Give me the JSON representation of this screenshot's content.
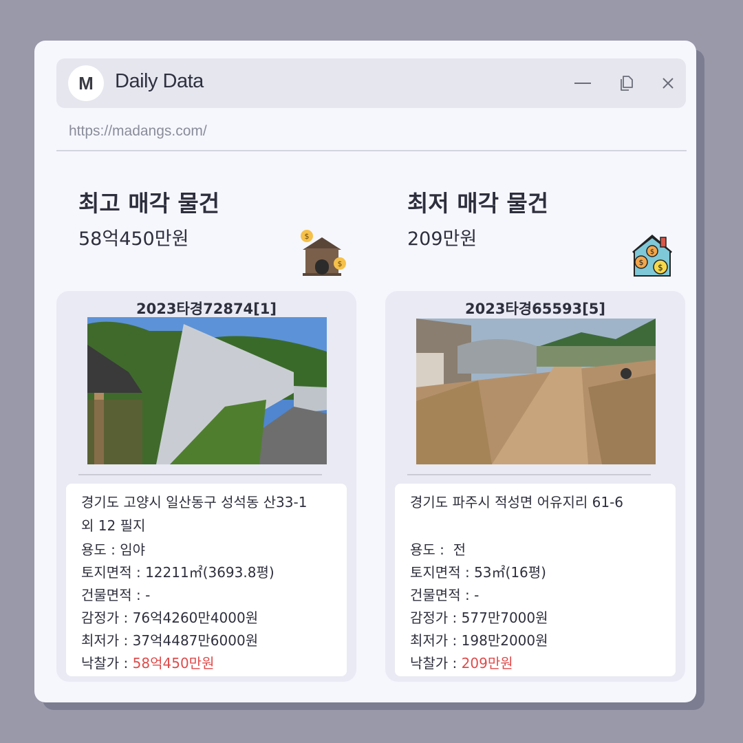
{
  "app": {
    "avatar_letter": "M",
    "title": "Daily Data",
    "url": "https://madangs.com/"
  },
  "icons": {
    "minimize": "minimize-icon",
    "copy": "copy-icon",
    "close": "close-icon",
    "left_section": "house-money-icon",
    "right_section": "house-coins-icon"
  },
  "left": {
    "section_title": "최고 매각 물건",
    "section_price": "58억450만원",
    "case_no": "2023타경72874[1]",
    "address_line1": "경기도 고양시 일산동구 성석동 산33-1",
    "address_line2": "외 12 필지",
    "usage_label": "용도 : ",
    "usage_value": "임야",
    "land_label": "토지면적 : ",
    "land_value": "12211㎡(3693.8평)",
    "building_label": "건물면적 : ",
    "building_value": "-",
    "appraisal_label": "감정가 : ",
    "appraisal_value": "76억4260만4000원",
    "minimum_label": "최저가 : ",
    "minimum_value": "37억4487만6000원",
    "winning_label": "낙찰가 : ",
    "winning_value": "58억450만원"
  },
  "right": {
    "section_title": "최저 매각 물건",
    "section_price": "209만원",
    "case_no": "2023타경65593[5]",
    "address_line1": "경기도 파주시 적성면 어유지리 61-6",
    "address_line2": "",
    "usage_label": "용도 : ",
    "usage_value": " 전",
    "land_label": "토지면적 : ",
    "land_value": "53㎡(16평)",
    "building_label": "건물면적 : ",
    "building_value": "-",
    "appraisal_label": "감정가 : ",
    "appraisal_value": "577만7000원",
    "minimum_label": "최저가 : ",
    "minimum_value": "198만2000원",
    "winning_label": "낙찰가 : ",
    "winning_value": "209만원"
  },
  "colors": {
    "accent_price": "#e04a4a",
    "background": "#9999aa",
    "window": "#f6f7fd"
  }
}
